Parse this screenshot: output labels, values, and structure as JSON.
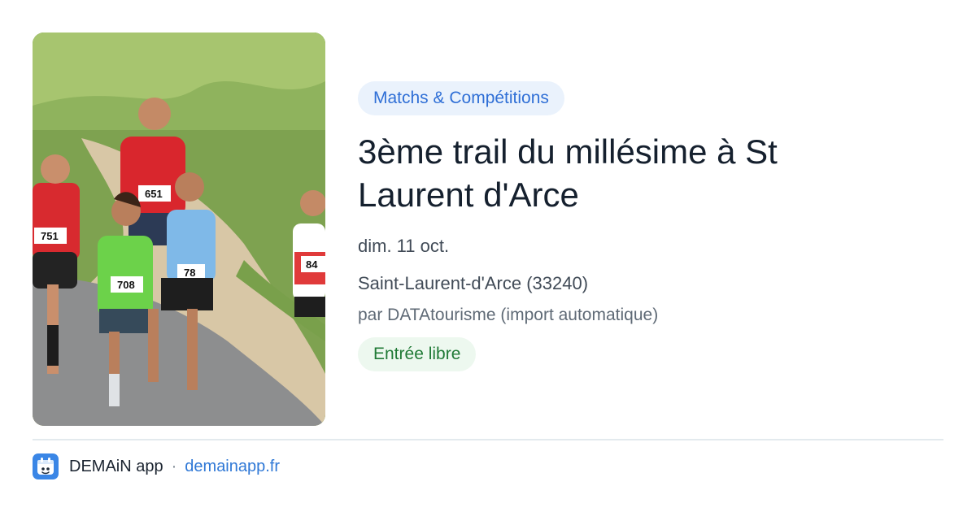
{
  "event": {
    "photo_icon": "trail-runners-photo",
    "category": "Matchs & Compétitions",
    "title": "3ème trail du millésime à St Laurent d'Arce",
    "date": "dim. 11 oct.",
    "location": "Saint-Laurent-d'Arce (33240)",
    "source": "par DATAtourisme (import automatique)",
    "price": "Entrée libre",
    "bibs": [
      "751",
      "651",
      "708",
      "78",
      "84"
    ]
  },
  "footer": {
    "app_icon": "calendar-app-icon",
    "app_name": "DEMAiN app",
    "separator": "·",
    "site": "demainapp.fr"
  },
  "colors": {
    "category_bg": "#eaf2fc",
    "category_text": "#2f6fd6",
    "price_bg": "#edf8ef",
    "price_text": "#207a36",
    "link": "#2f78d6",
    "app_icon_bg": "#3a86e6"
  }
}
